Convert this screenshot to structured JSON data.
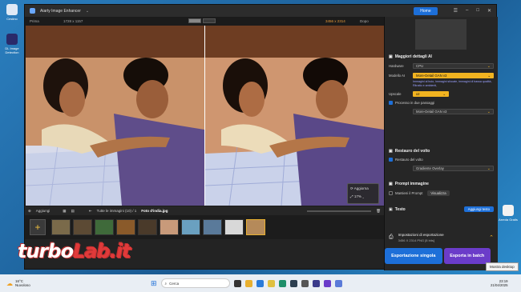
{
  "desktop": {
    "icons": [
      {
        "label": "Cestino"
      },
      {
        "label": "DL Image Detection"
      },
      {
        "label": "Arreda Gratis"
      },
      {
        "label": "Mostra desktop"
      }
    ]
  },
  "app": {
    "title": "Aiarty Image Enhancer",
    "home_label": "Home",
    "viewer": {
      "before_label": "Prima",
      "before_dims": "1728 x 1157",
      "after_dims": "3456 x 2314",
      "after_label": "Dopo",
      "zoom_update": "Aggiorna",
      "zoom_value": "17%"
    },
    "filebar": {
      "add_label": "Aggiungi",
      "all_images": "Tutte le immagini (10) / 1",
      "filename": "Foto d'india.jpg"
    },
    "panel": {
      "section_details": "Maggiori dettagli AI",
      "hardware_label": "Hardware",
      "hardware_value": "CPU",
      "model_label": "Modello AI",
      "model_value": "More-Detail GAN v3",
      "model_note": "Immagini al buio, immagini sfocate, immagini di bassa qualità, Ritratto e ambienti,",
      "scale_label": "Upscale",
      "scale_value": "x2",
      "two_pass_label": "Processo in due passaggi",
      "two_pass_model": "More-Detail GAN v3",
      "section_face": "Restauro del volto",
      "face_check_label": "Restauro del volto",
      "face_model": "Gradiente Overlay",
      "section_prompt": "Prompt immagine",
      "prompt_check_label": "Mantieni il Prompt",
      "prompt_btn": "Visualizza",
      "section_text": "Testo",
      "text_btn": "Aggiungi testo",
      "export_settings": "Impostazioni di esportazione",
      "export_info": "3456 X 2314   PNG   [8 bits]",
      "export_single": "Esportazione singola",
      "export_batch": "Esporta in batch"
    }
  },
  "taskbar": {
    "temp": "16°C",
    "weather": "Nuvoloso",
    "search": "Cerca",
    "time": "23:19",
    "date": "21/04/2025",
    "tooltip": "Mostra desktop"
  },
  "watermark": {
    "part1": "turbo",
    "part2": "Lab.it"
  },
  "colors": {
    "accent": "#1d6fd8",
    "highlight": "#f1b320",
    "batch": "#6b3cc9"
  }
}
